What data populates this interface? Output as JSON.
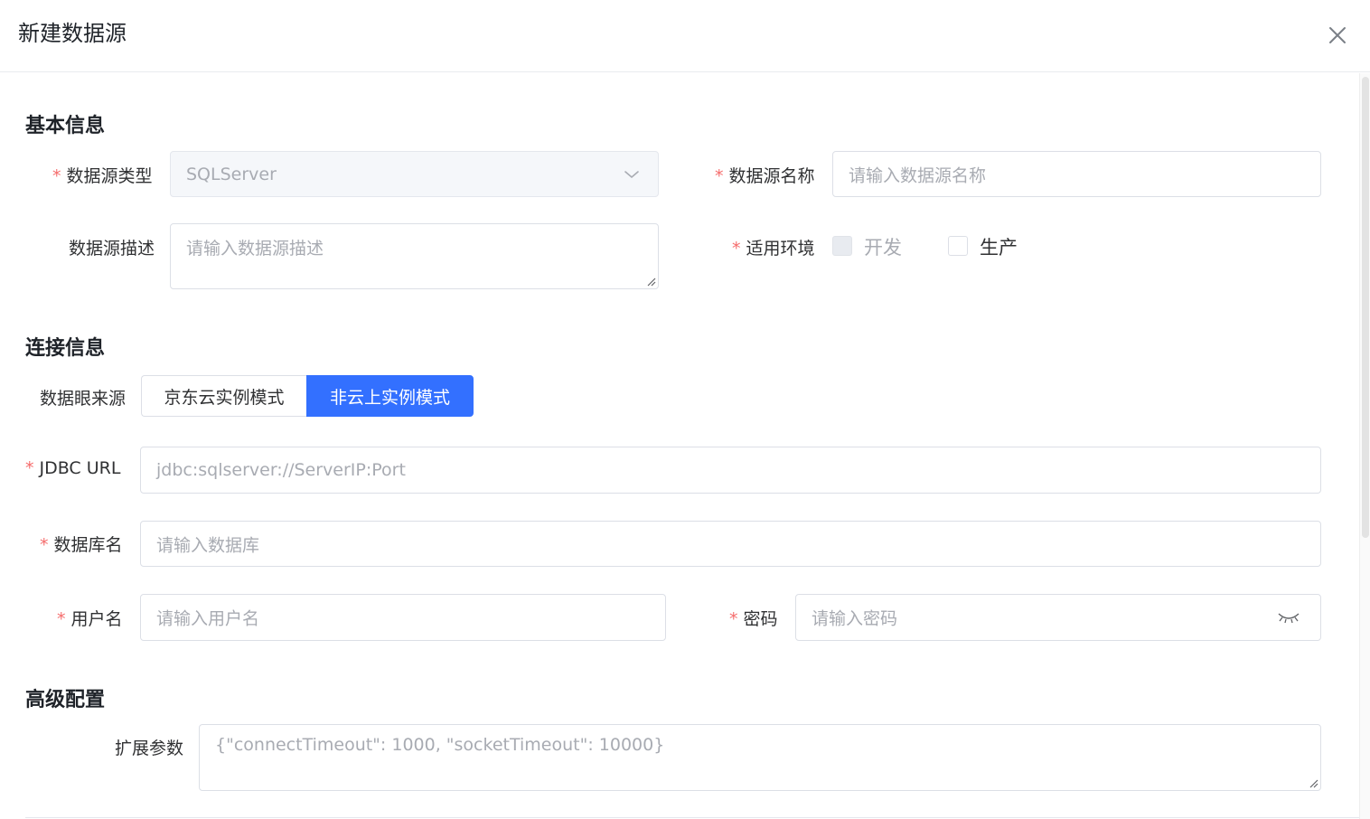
{
  "dialog": {
    "title": "新建数据源"
  },
  "icons": {
    "close": "close-icon",
    "dropdown": "chevron-down-icon",
    "password_toggle": "eye-closed-icon",
    "resize": "resize-handle-icon"
  },
  "colors": {
    "primary": "#3370ff",
    "required": "#f56c6c",
    "placeholder": "#a8abb2"
  },
  "basic": {
    "section_title": "基本信息",
    "type_label": "数据源类型",
    "type_value": "SQLServer",
    "name_label": "数据源名称",
    "name_placeholder": "请输入数据源名称",
    "desc_label": "数据源描述",
    "desc_placeholder": "请输入数据源描述",
    "env_label": "适用环境",
    "env_options": [
      {
        "label": "开发",
        "checked": false,
        "disabled": true
      },
      {
        "label": "生产",
        "checked": false,
        "disabled": false
      }
    ]
  },
  "connection": {
    "section_title": "连接信息",
    "source_label": "数据眼来源",
    "source_options": [
      {
        "label": "京东云实例模式",
        "selected": false
      },
      {
        "label": "非云上实例模式",
        "selected": true
      }
    ],
    "jdbc_label": "JDBC URL",
    "jdbc_placeholder": "jdbc:sqlserver://ServerIP:Port",
    "db_label": "数据库名",
    "db_placeholder": "请输入数据库",
    "user_label": "用户名",
    "user_placeholder": "请输入用户名",
    "password_label": "密码",
    "password_placeholder": "请输入密码"
  },
  "advanced": {
    "section_title": "高级配置",
    "params_label": "扩展参数",
    "params_placeholder": "{\"connectTimeout\": 1000, \"socketTimeout\": 10000}"
  }
}
